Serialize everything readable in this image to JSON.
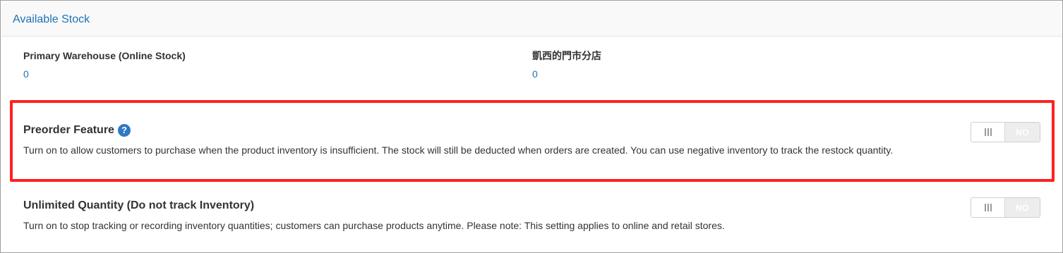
{
  "panel": {
    "title": "Available Stock"
  },
  "stock_locations": [
    {
      "name": "Primary Warehouse (Online Stock)",
      "value": "0"
    },
    {
      "name": "凱西的門市分店",
      "value": "0"
    }
  ],
  "settings": {
    "preorder": {
      "title": "Preorder Feature",
      "help_icon": "?",
      "description": "Turn on to allow customers to purchase when the product inventory is insufficient. The stock will still be deducted when orders are created. You can use negative inventory to track the restock quantity.",
      "toggle_label": "NO",
      "enabled": false,
      "highlighted": true,
      "highlight_color": "#ff2020"
    },
    "unlimited": {
      "title": "Unlimited Quantity (Do not track Inventory)",
      "description": "Turn on to stop tracking or recording inventory quantities; customers can purchase products anytime. Please note: This setting applies to online and retail stores.",
      "toggle_label": "NO",
      "enabled": false
    }
  },
  "colors": {
    "link": "#1a73b8",
    "help_icon": "#2e78c4",
    "toggle_off": "#ededed"
  }
}
